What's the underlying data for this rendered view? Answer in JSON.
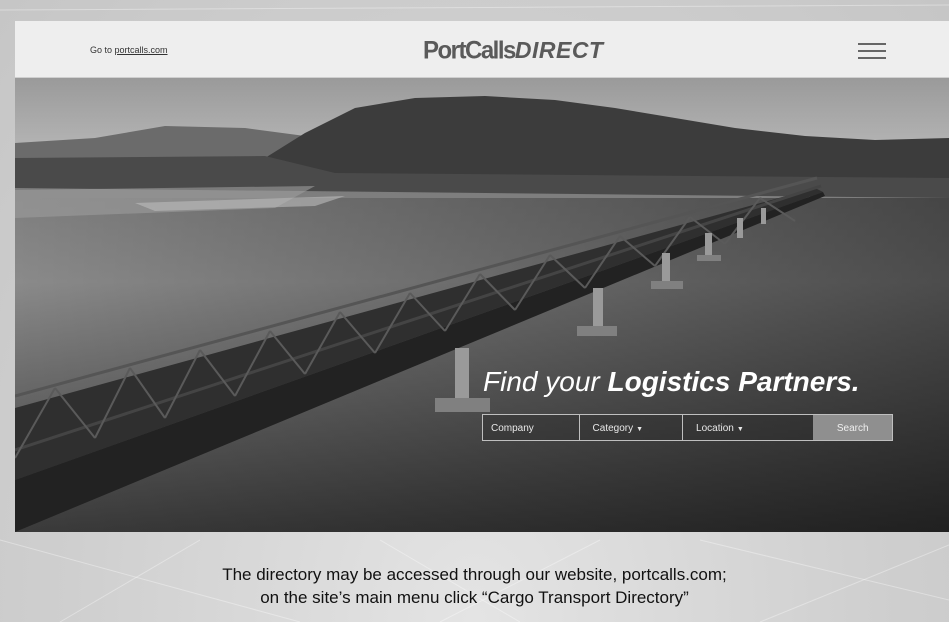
{
  "header": {
    "goto_prefix": "Go to ",
    "goto_link": "portcalls.com",
    "logo_part1": "PortCalls",
    "logo_part2": "DIRECT",
    "menu_icon": "hamburger-menu-icon"
  },
  "hero": {
    "tagline_light": "Find your ",
    "tagline_bold": "Logistics Partners.",
    "search": {
      "company_placeholder": "Company",
      "category_label": "Category",
      "location_label": "Location",
      "dropdown_icon": "caret-down-icon",
      "button_label": "Search"
    }
  },
  "caption": {
    "line1": "The directory may be accessed through our website, portcalls.com;",
    "line2": "on the site’s main menu click “Cargo Transport Directory”"
  }
}
